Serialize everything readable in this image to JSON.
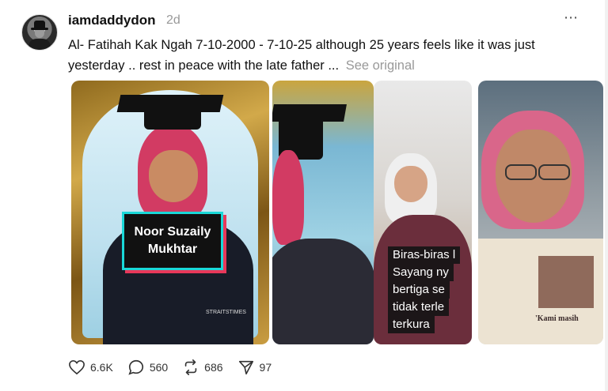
{
  "post": {
    "username": "iamdaddydon",
    "time": "2d",
    "more_icon": "⋯",
    "caption": "Al- Fatihah Kak Ngah 7-10-2000 - 7-10-25 although 25 years feels like it was just yesterday .. rest in peace with the late father ...",
    "see_original": "See original"
  },
  "media": {
    "card1": {
      "name_label": "Noor Suzaily Mukhtar",
      "watermark": "STRAITSTIMES"
    },
    "card3": {
      "sub_lines": [
        "Biras-biras l",
        "Sayang ny",
        "bertiga se",
        "tidak terle",
        "terkura"
      ]
    },
    "card4": {
      "headline": "'Kami masih"
    }
  },
  "actions": {
    "likes": "6.6K",
    "comments": "560",
    "reposts": "686",
    "shares": "97"
  }
}
